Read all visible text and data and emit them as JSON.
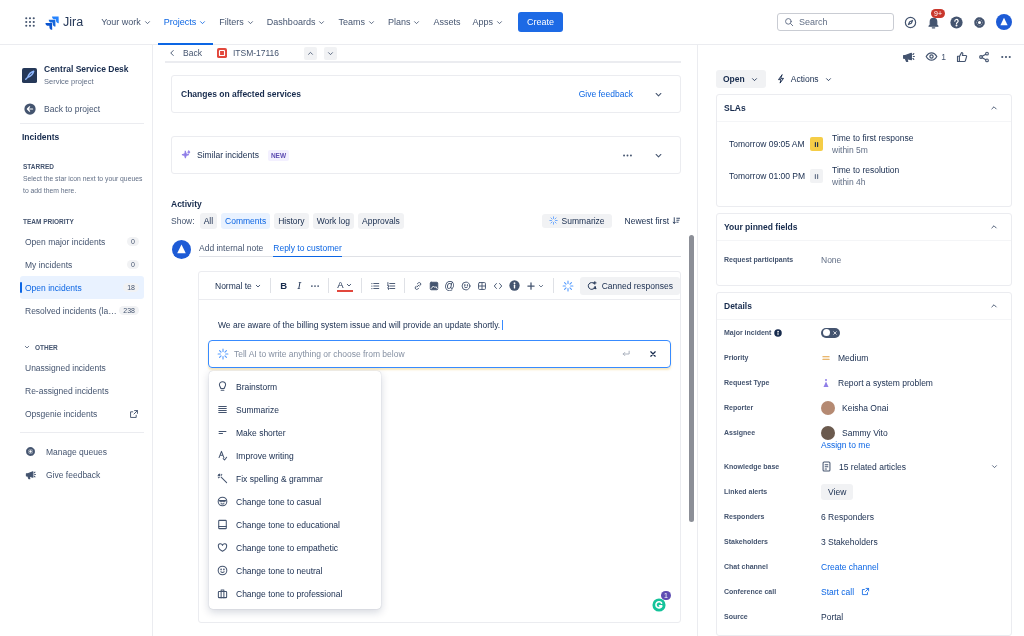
{
  "nav": {
    "product": "Jira",
    "items": [
      {
        "label": "Your work",
        "dropdown": true,
        "selected": false
      },
      {
        "label": "Projects",
        "dropdown": true,
        "selected": true
      },
      {
        "label": "Filters",
        "dropdown": true,
        "selected": false
      },
      {
        "label": "Dashboards",
        "dropdown": true,
        "selected": false
      },
      {
        "label": "Teams",
        "dropdown": true,
        "selected": false
      },
      {
        "label": "Plans",
        "dropdown": true,
        "selected": false
      },
      {
        "label": "Assets",
        "dropdown": false,
        "selected": false
      },
      {
        "label": "Apps",
        "dropdown": true,
        "selected": false
      }
    ],
    "create": "Create",
    "search": {
      "placeholder": "Search"
    },
    "notification_badge": "9+"
  },
  "sidebar": {
    "project": {
      "name": "Central Service Desk",
      "type": "Service project"
    },
    "back": "Back to project",
    "section_title": "Incidents",
    "starred": {
      "heading": "STARRED",
      "hint": "Select the star icon next to your queues to add them here."
    },
    "groups": [
      {
        "heading": "TEAM PRIORITY",
        "items": [
          {
            "label": "Open major incidents",
            "count": "0",
            "external": false,
            "selected": false
          },
          {
            "label": "My incidents",
            "count": "0",
            "external": false,
            "selected": false
          },
          {
            "label": "Open incidents",
            "count": "18",
            "external": false,
            "selected": true
          },
          {
            "label": "Resolved incidents (la…",
            "count": "238",
            "external": false,
            "selected": false
          }
        ]
      },
      {
        "heading": "OTHER",
        "expanded": true,
        "items": [
          {
            "label": "Unassigned incidents",
            "external": false,
            "selected": false
          },
          {
            "label": "Re-assigned incidents",
            "external": false,
            "selected": false
          },
          {
            "label": "Opsgenie incidents",
            "external": true,
            "selected": false
          }
        ]
      }
    ],
    "footer": [
      "Manage queues",
      "Give feedback"
    ]
  },
  "issue": {
    "back": "Back",
    "key": "ITSM-17116",
    "panels": [
      {
        "kind": "feedback",
        "title": "Changes on affected services",
        "link": "Give feedback",
        "expanded": false
      },
      {
        "kind": "ai",
        "title": "Similar incidents",
        "badge": "NEW",
        "expanded": false
      }
    ],
    "activity": {
      "heading": "Activity",
      "show_label": "Show:",
      "filters": [
        {
          "label": "All",
          "selected": false
        },
        {
          "label": "Comments",
          "selected": true
        },
        {
          "label": "History",
          "selected": false
        },
        {
          "label": "Work log",
          "selected": false
        },
        {
          "label": "Approvals",
          "selected": false
        }
      ],
      "summarize": "Summarize",
      "sort": "Newest first"
    },
    "comment_tabs": [
      {
        "label": "Add internal note",
        "selected": false
      },
      {
        "label": "Reply to customer",
        "selected": true
      }
    ],
    "toolbar": {
      "text_style": "Normal te",
      "marks": [
        "B",
        "I"
      ],
      "color_letter": "A",
      "mention": "@",
      "canned": "Canned responses"
    },
    "body": "We are aware of the billing system issue and will provide an update shortly.",
    "ai_prompt": {
      "placeholder": "Tell AI to write anything or choose from below"
    },
    "ai_menu": [
      "Brainstorm",
      "Summarize",
      "Make shorter",
      "Improve writing",
      "Fix spelling & grammar",
      "Change tone to casual",
      "Change tone to educational",
      "Change tone to empathetic",
      "Change tone to neutral",
      "Change tone to professional"
    ],
    "assistant_badge": "1"
  },
  "side": {
    "watchers": "1",
    "status": "Open",
    "actions": "Actions",
    "slas": {
      "title": "SLAs",
      "expanded": true,
      "items": [
        {
          "time": "Tomorrow 09:05 AM",
          "active": true,
          "name": "Time to first response",
          "goal": "within 5m"
        },
        {
          "time": "Tomorrow 01:00 PM",
          "active": false,
          "name": "Time to resolution",
          "goal": "within 4h"
        }
      ]
    },
    "pinned": {
      "title": "Your pinned fields",
      "expanded": true,
      "fields": [
        {
          "label": "Request participants",
          "kind": "empty",
          "value": "None"
        }
      ]
    },
    "details": {
      "title": "Details",
      "expanded": true,
      "fields": [
        {
          "label": "Major incident",
          "has_info": true,
          "kind": "toggle",
          "on": false
        },
        {
          "label": "Priority",
          "kind": "priority",
          "value": "Medium"
        },
        {
          "label": "Request Type",
          "kind": "request_type",
          "value": "Report a system problem"
        },
        {
          "label": "Reporter",
          "kind": "user",
          "value": "Keisha Onai"
        },
        {
          "label": "Assignee",
          "kind": "user",
          "value": "Sammy Vito",
          "link": "Assign to me"
        },
        {
          "label": "Knowledge base",
          "kind": "articles",
          "value": "15 related articles"
        },
        {
          "label": "Linked alerts",
          "kind": "button",
          "value": "View"
        },
        {
          "label": "Responders",
          "kind": "text",
          "value": "6 Responders"
        },
        {
          "label": "Stakeholders",
          "kind": "text",
          "value": "3 Stakeholders"
        },
        {
          "label": "Chat channel",
          "kind": "link",
          "value": "Create channel"
        },
        {
          "label": "Conference call",
          "kind": "external_link",
          "value": "Start call"
        },
        {
          "label": "Source",
          "kind": "text",
          "value": "Portal"
        }
      ]
    }
  }
}
